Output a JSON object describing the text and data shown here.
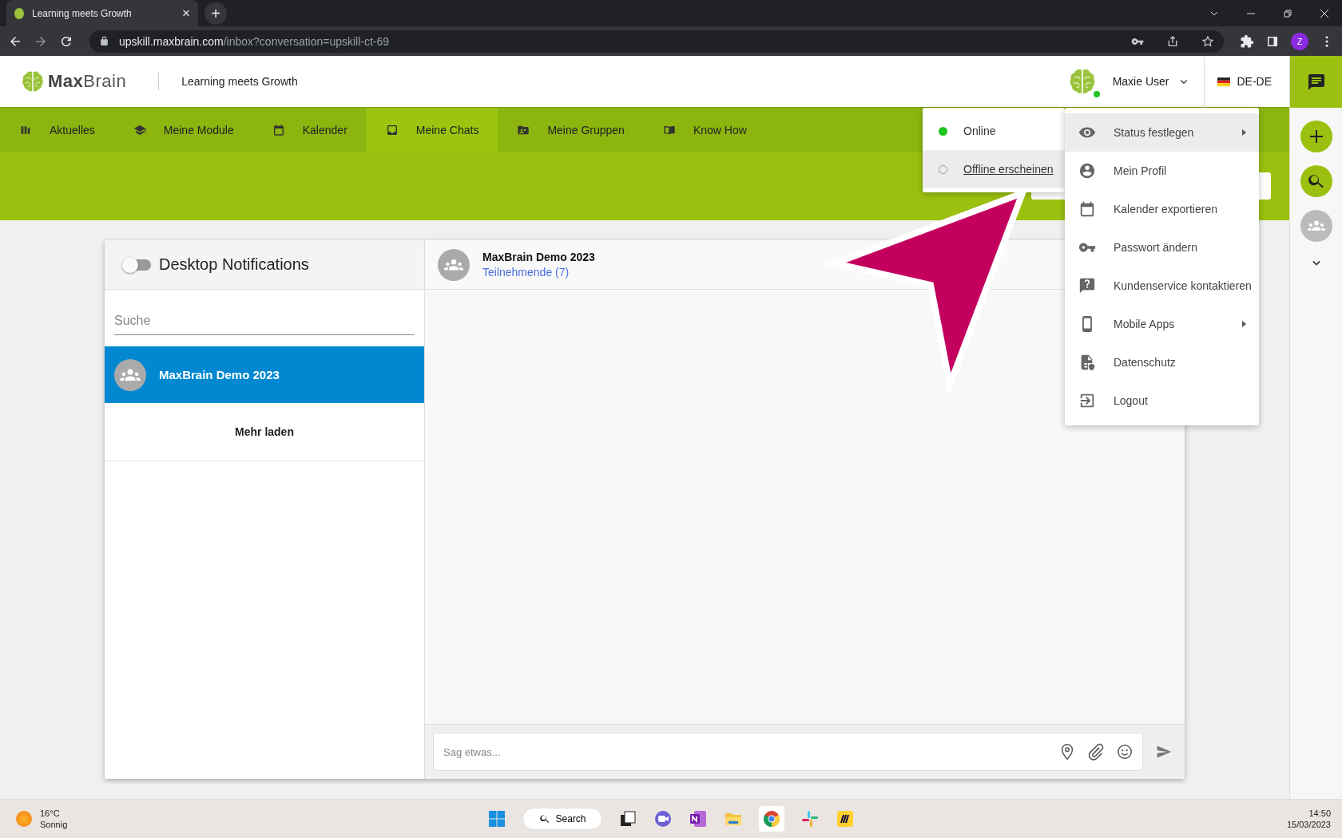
{
  "browser": {
    "tab_title": "Learning meets Growth",
    "tab_close": "×",
    "new_tab": "+",
    "url_host": "upskill.maxbrain.com",
    "url_path": "/inbox?conversation=upskill-ct-69",
    "profile_initial": "Z"
  },
  "header": {
    "logo_bold": "Max",
    "logo_light": "Brain",
    "tagline": "Learning meets Growth",
    "user_name": "Maxie User",
    "user_online": true,
    "language": "DE-DE"
  },
  "nav": [
    {
      "label": "Aktuelles",
      "selected": false
    },
    {
      "label": "Meine Module",
      "selected": false
    },
    {
      "label": "Kalender",
      "selected": false
    },
    {
      "label": "Meine Chats",
      "selected": true
    },
    {
      "label": "Meine Gruppen",
      "selected": false
    },
    {
      "label": "Know How",
      "selected": false
    }
  ],
  "status_menu": [
    {
      "label": "Online",
      "kind": "online",
      "highlighted": false
    },
    {
      "label": "Offline erscheinen",
      "kind": "offline",
      "highlighted": true
    }
  ],
  "user_menu": [
    {
      "label": "Status festlegen",
      "submenu": true,
      "highlighted": true
    },
    {
      "label": "Mein Profil",
      "submenu": false,
      "highlighted": false
    },
    {
      "label": "Kalender exportieren",
      "submenu": false,
      "highlighted": false
    },
    {
      "label": "Passwort ändern",
      "submenu": false,
      "highlighted": false
    },
    {
      "label": "Kundenservice kontaktieren",
      "submenu": false,
      "highlighted": false
    },
    {
      "label": "Mobile Apps",
      "submenu": true,
      "highlighted": false
    },
    {
      "label": "Datenschutz",
      "submenu": false,
      "highlighted": false
    },
    {
      "label": "Logout",
      "submenu": false,
      "highlighted": false
    }
  ],
  "chat_list": {
    "title": "Desktop Notifications",
    "notifications_on": false,
    "search_placeholder": "Suche",
    "conversations": [
      {
        "name": "MaxBrain Demo 2023",
        "selected": true
      }
    ],
    "load_more": "Mehr laden"
  },
  "conversation": {
    "title": "MaxBrain Demo 2023",
    "participants": "Teilnehmende (7)",
    "message_placeholder": "Sag etwas..."
  },
  "taskbar": {
    "temperature": "16°C",
    "weather": "Sonnig",
    "search": "Search",
    "time": "14:50",
    "date": "15/03/2023"
  }
}
